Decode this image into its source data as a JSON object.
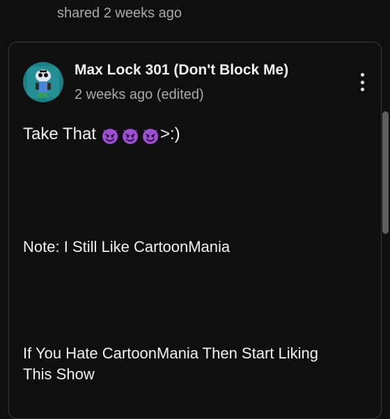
{
  "header": {
    "shared_text": "shared 2 weeks ago"
  },
  "post": {
    "author": "Max Lock 301 (Don't Block Me)",
    "timestamp": "2 weeks ago (edited)",
    "line1_text": "Take That",
    "line1_suffix": ">:)",
    "emoji_icon": "smiling-face-with-horns-icon",
    "emoji_count": 3,
    "line2": "Note: I Still Like CartoonMania",
    "line3": "If You Hate CartoonMania Then Start Liking",
    "line4": "This Show"
  },
  "colors": {
    "background": "#0f0f0f",
    "text_primary": "#f1f1f1",
    "text_secondary": "#aaaaaa",
    "card_border": "#3a3a3a",
    "emoji_purple": "#9b4fd1"
  }
}
